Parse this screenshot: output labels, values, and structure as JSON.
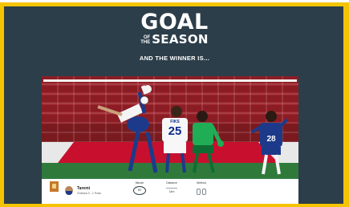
{
  "header": {
    "title_goal": "GOAL",
    "title_of": "OF",
    "title_the": "THE",
    "title_season": "SEASON"
  },
  "announcement": "AND THE WINNER IS...",
  "photo": {
    "icon": "stadium-photo",
    "jersey_number_1": "25",
    "jersey_number_2": "28",
    "jersey_name": "FIKS"
  },
  "info_bar": {
    "player_name": "Taremi",
    "player_sub": "Chelsea 0 - 1 Porto",
    "stats": [
      {
        "label": "Minute",
        "value": "90'"
      },
      {
        "label": "Distance",
        "value": "14m"
      },
      {
        "label": "Method",
        "value": ""
      }
    ]
  },
  "colors": {
    "frame": "#f5c400",
    "panel": "#2c3e4a",
    "text": "#ffffff"
  }
}
